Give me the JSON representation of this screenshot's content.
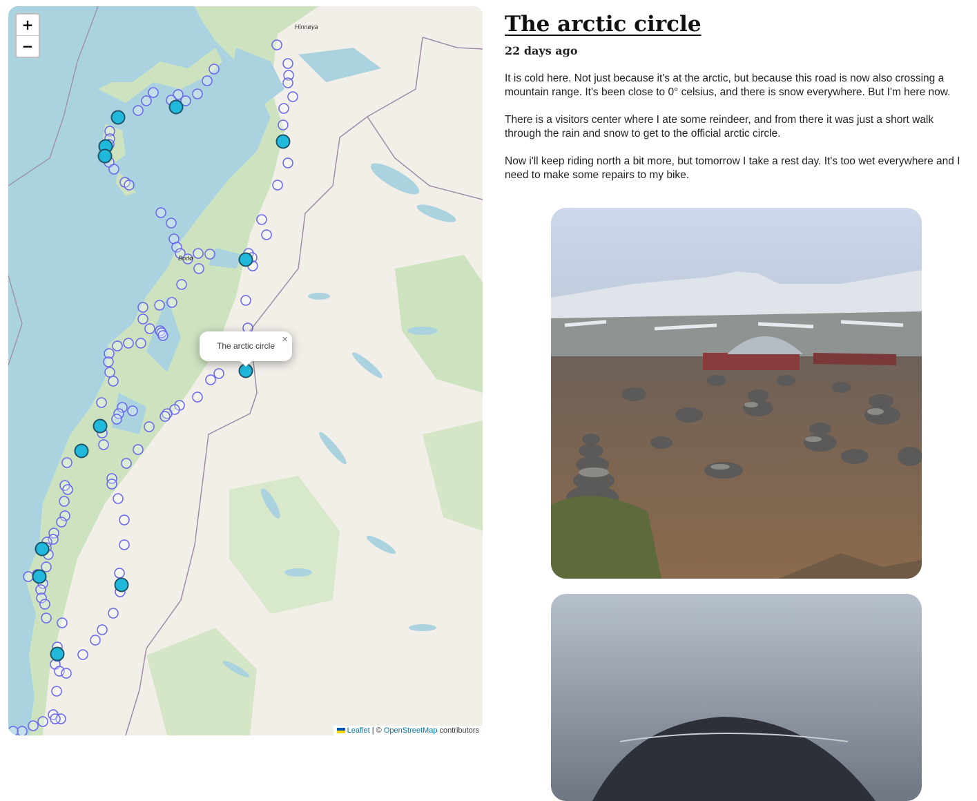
{
  "map": {
    "zoom_in_label": "+",
    "zoom_out_label": "−",
    "labels": {
      "hinnoya": "Hinnøya",
      "bodo": "Bodø"
    },
    "popup": {
      "text": "The arctic circle",
      "close": "×"
    },
    "attribution": {
      "leaflet": "Leaflet",
      "separator": "| ©",
      "osm": "OpenStreetMap",
      "suffix": "contributors"
    }
  },
  "post": {
    "title": "The arctic circle",
    "date": "22 days ago",
    "paragraphs": [
      "It is cold here. Not just because it's at the arctic, but because this road is now also crossing a mountain range. It's been close to 0° celsius, and there is snow everywhere. But I'm here now.",
      "There is a visitors center where I ate some reindeer, and from there it was just a short walk through the rain and snow to get to the official arctic circle.",
      "Now i'll keep riding north a bit more, but tomorrow I take a rest day. It's too wet everywhere and I need to make some repairs to my bike."
    ]
  },
  "colors": {
    "sea": "#aad3df",
    "land": "#f2efe9",
    "forest": "#cde3c0",
    "marker_stroke": "#6666ee",
    "marker_fill": "#20b9dc"
  }
}
